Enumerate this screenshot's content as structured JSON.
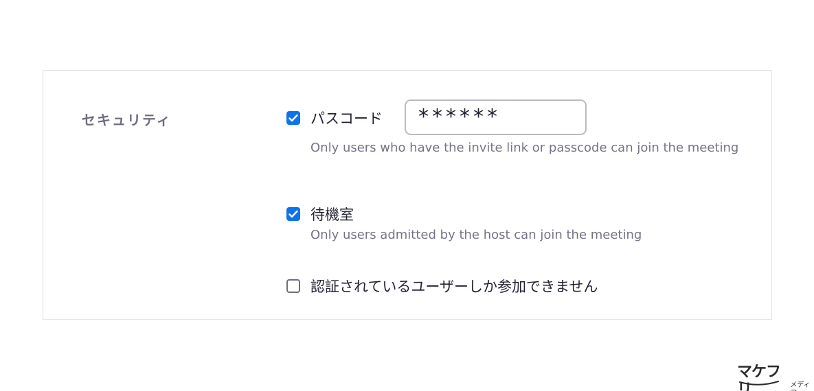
{
  "security": {
    "section_label": "セキュリティ",
    "passcode": {
      "label": "パスコード",
      "checked": true,
      "value": "******",
      "description": "Only users who have the invite link or passcode can join the meeting"
    },
    "waiting_room": {
      "label": "待機室",
      "checked": true,
      "description": "Only users admitted by the host can join the meeting"
    },
    "authenticated_only": {
      "label": "認証されているユーザーしか参加できません",
      "checked": false
    }
  },
  "brand": {
    "logo_text": "マケフリ",
    "logo_subtext": "メディア"
  },
  "colors": {
    "accent": "#0e72ed",
    "section_label": "#6e6e7e",
    "description": "#747487",
    "panel_border": "#e2e2e7"
  },
  "icons": {
    "checked": "checkmark-icon",
    "brand": "smile-swoosh-icon"
  }
}
